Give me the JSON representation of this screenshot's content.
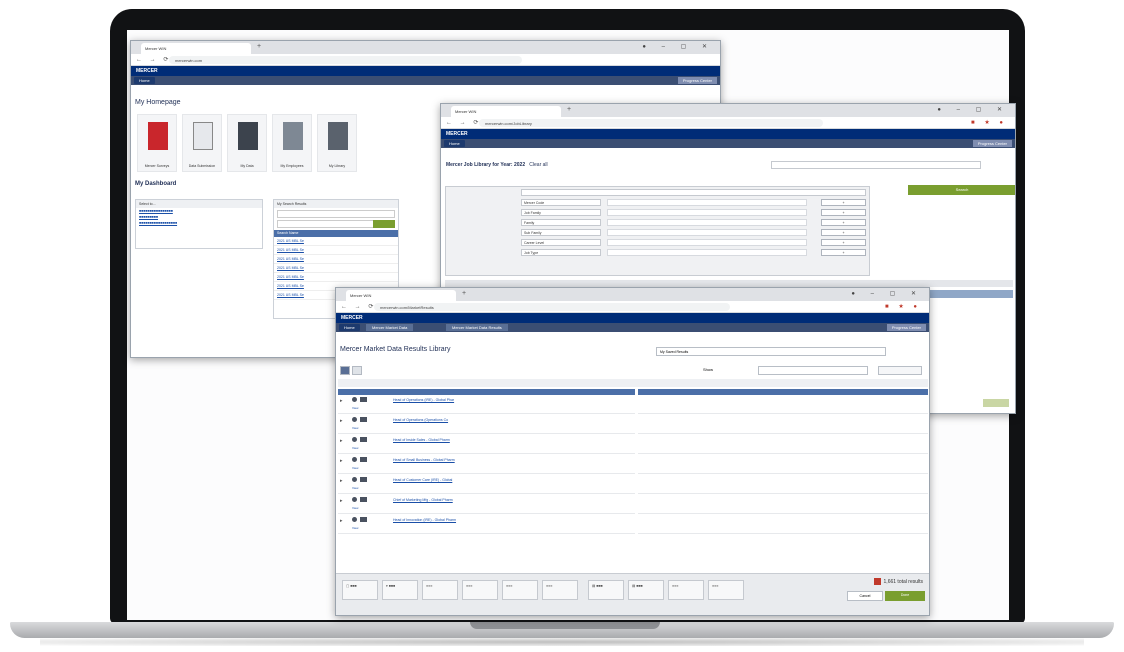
{
  "colors": {
    "brand": "#002c77",
    "accent_green": "#7a9e2f",
    "link": "#1a4fa8"
  },
  "app": {
    "logo": "MERCER",
    "home_label": "Home",
    "progress_center": "Progress Center"
  },
  "window1": {
    "tab": "Mercer WIN",
    "url": "mercerwin.com",
    "page_title": "My Homepage",
    "apps": [
      {
        "label": "Mercer Surveys"
      },
      {
        "label": "Data Submission"
      },
      {
        "label": "My Data"
      },
      {
        "label": "My Employees"
      },
      {
        "label": "My Library"
      }
    ],
    "dashboard_title": "My Dashboard",
    "panel_left_title": "Select to...",
    "panel_right_title": "My Search Results",
    "panel_right_header": "Search Name",
    "results": [
      "2021 US MBL Se",
      "2021 US MBL Se",
      "2021 US MBL Se",
      "2021 US MBL Se",
      "2021 US MBL Se",
      "2021 US MBL Se",
      "2021 US MBL Se"
    ]
  },
  "window2": {
    "tab": "Mercer WIN",
    "url": "mercerwin.com/JobLibrary",
    "page_title": "Mercer Job Library for Year: 2022",
    "clear_all": "Clear all",
    "search_button": "Search",
    "filters": [
      "Mercer Code",
      "Job Family",
      "Family",
      "Sub Family",
      "Career Level",
      "Job Type"
    ]
  },
  "window3": {
    "tab": "Mercer WIN",
    "url": "mercerwin.com/MarketResults",
    "breadcrumb_1": "Mercer Market Data",
    "breadcrumb_2": "Mercer Market Data Results",
    "page_title": "Mercer Market Data Results Library",
    "select_placeholder": "My Saved Results",
    "view_label": "Show",
    "rows": [
      "Head of Operations (IRE) - Global Phar",
      "Head of Operations (Operations Co",
      "Head of Inside Sales - Global Pharm",
      "Head of Small Business - Global Pharm",
      "Head of Customer Care (IRE) - Global",
      "Chief of Marketing Mfg - Global Pharm",
      "Head of Innovation (IRE) - Global Pharm"
    ],
    "view_text": "View",
    "footer_count": "1,661 total results",
    "footer_cancel": "Cancel",
    "footer_go": "Done"
  }
}
